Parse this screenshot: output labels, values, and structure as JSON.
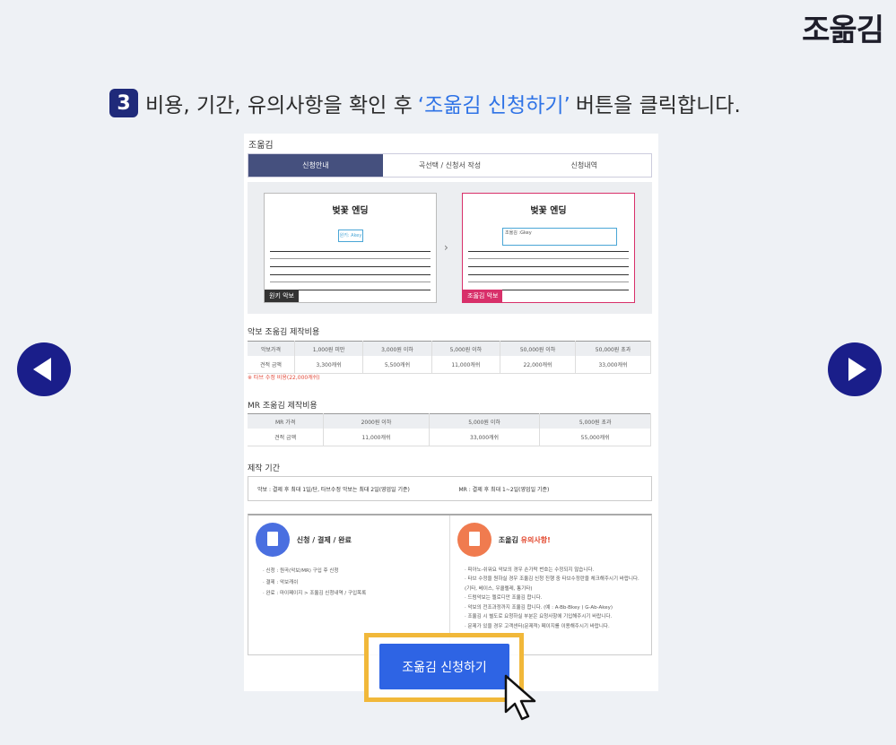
{
  "brand": "조옮김",
  "headline": {
    "step": "3",
    "pre": "비용, 기간, 유의사항을 확인 후",
    "highlight": "‘조옮김 신청하기’",
    "post": "버튼을 클릭합니다."
  },
  "panel": {
    "title": "조옮김",
    "steps": [
      "신청안내",
      "곡선택 / 신청서 작성",
      "신청내역"
    ],
    "preview": {
      "title": "벚꽃 엔딩",
      "orig_tag": "원키 악보",
      "trans_tag": "조옮김 악보",
      "orig_note": "원키: Akey",
      "trans_note": "조옮김 :Gkey"
    },
    "sheet_fee": {
      "title": "악보 조옮김 제작비용",
      "headers": [
        "악보가격",
        "1,000원 미만",
        "3,000원 이하",
        "5,000원 이하",
        "50,000원 이하",
        "50,000원 초과"
      ],
      "row": [
        "견적 금액",
        "3,300캐쉬",
        "5,500캐쉬",
        "11,000캐쉬",
        "22,000캐쉬",
        "33,000캐쉬"
      ],
      "warn": "※ 타브 수정 비용(22,000캐쉬)"
    },
    "mr_fee": {
      "title": "MR 조옮김 제작비용",
      "headers": [
        "MR 가격",
        "2000원 이하",
        "5,000원 이하",
        "5,000원 초과"
      ],
      "row": [
        "견적 금액",
        "11,000캐쉬",
        "33,000캐쉬",
        "55,000캐쉬"
      ]
    },
    "period": {
      "title": "제작 기간",
      "sheet": "악보 : 결제 후 최대 1일/단, 타브수정 악보는 최대 2일(영업일 기준)",
      "mr": "MR : 결제 후 최대 1~2일(영업일 기준)"
    },
    "info_left": {
      "title": "신청 / 결제 / 완료",
      "items": [
        "· 신청 : 원곡(악보/MR) 구입 후 신청",
        "· 결제 : 악보캐쉬",
        "· 완료 : 마이페이지 > 조옮김 신청내역 / 구입목록"
      ]
    },
    "info_right": {
      "title_pre": "조옮김",
      "title_red": "유의사항!",
      "items": [
        "· 피아노-쉬워요 악보의 경우 손가락 번호는 수정되지 않습니다.",
        "· 타브 수정을 원하실 경우 조옮김 신청 진행 중 타브수정란을 체크해주시기 바랍니다. (기타, 베이스, 우쿨렐레, 통기타)",
        "· 드럼악보는 멜로디만 조옮김 합니다.",
        "· 악보의 전조과정까지 조옮김 합니다. (예 : A-Bb-Bkey ) G-Ab-Akey)",
        "· 조옮김 시 별도로 요청하실 부분은 요청사항에 기입해주시기 바랍니다.",
        "· 문제가 있을 경우 고객센터(문제적) 페이지를 이용해주시기 바랍니다."
      ]
    }
  },
  "cta": "조옮김 신청하기",
  "colors": {
    "accent": "#2e64e4",
    "nav": "#1a1e8a",
    "highlight": "#2f73e6",
    "frame": "#f1b83a"
  },
  "icons": {
    "prev": "chevron-left-icon",
    "next": "chevron-right-icon",
    "cursor": "mouse-pointer-icon"
  }
}
